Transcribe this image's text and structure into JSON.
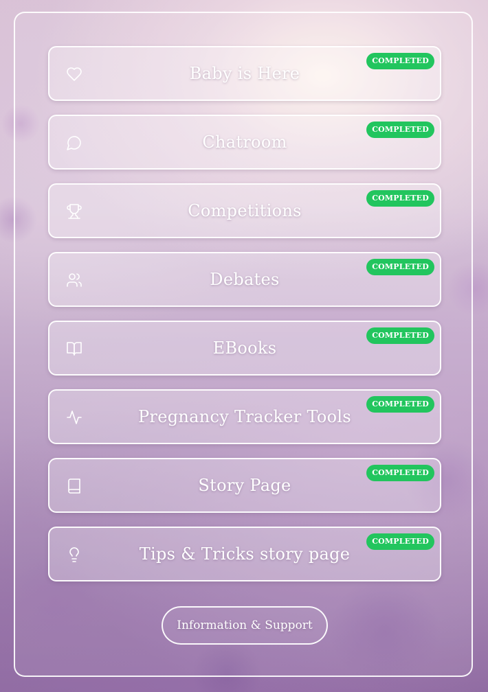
{
  "items": [
    {
      "label": "Baby is Here",
      "icon": "heart-icon",
      "status": "COMPLETED"
    },
    {
      "label": "Chatroom",
      "icon": "chat-bubble-icon",
      "status": "COMPLETED"
    },
    {
      "label": "Competitions",
      "icon": "trophy-icon",
      "status": "COMPLETED"
    },
    {
      "label": "Debates",
      "icon": "users-icon",
      "status": "COMPLETED"
    },
    {
      "label": "EBooks",
      "icon": "open-book-icon",
      "status": "COMPLETED"
    },
    {
      "label": "Pregnancy Tracker Tools",
      "icon": "activity-icon",
      "status": "COMPLETED"
    },
    {
      "label": "Story Page",
      "icon": "book-icon",
      "status": "COMPLETED"
    },
    {
      "label": "Tips & Tricks story page",
      "icon": "lightbulb-icon",
      "status": "COMPLETED"
    }
  ],
  "footer": {
    "info_button_label": "Information & Support"
  },
  "colors": {
    "badge_green": "#22c55e",
    "text": "#ffffff"
  }
}
